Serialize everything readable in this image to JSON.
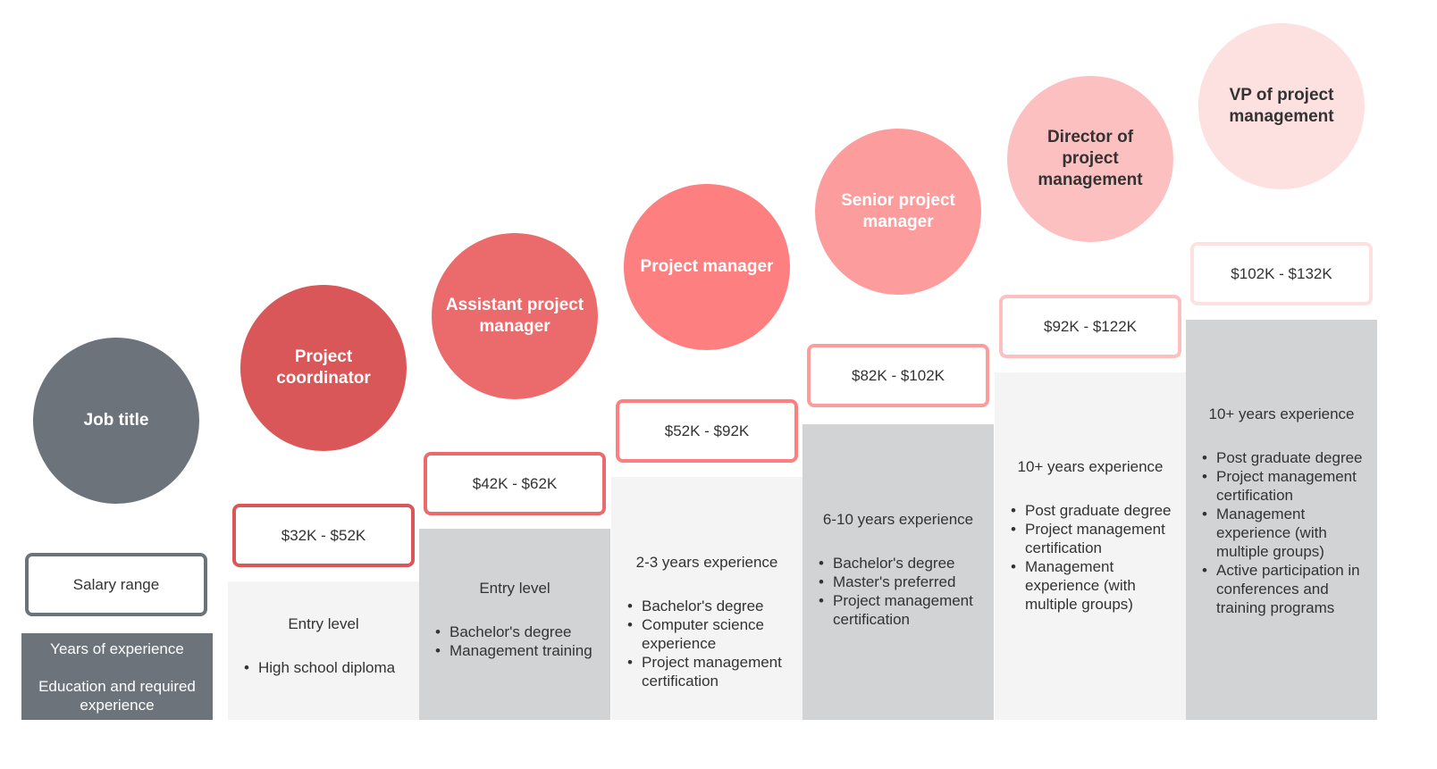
{
  "legend": {
    "job_title": "Job title",
    "salary_range": "Salary range",
    "years_of_experience": "Years of experience",
    "education": "Education and required experience",
    "circle_color": "#6d737b",
    "box_border_color": "#6d737b"
  },
  "levels": [
    {
      "title": "Project coordinator",
      "salary": "$32K - $52K",
      "experience": "Entry level",
      "requirements": [
        "High school diploma"
      ],
      "circle_color": "#d95758",
      "border_color": "#d95758",
      "title_color": "#ffffff",
      "block_color": "#f4f4f4"
    },
    {
      "title": "Assistant project manager",
      "salary": "$42K - $62K",
      "experience": "Entry level",
      "requirements": [
        "Bachelor's degree",
        "Management training"
      ],
      "circle_color": "#eb6b6c",
      "border_color": "#eb6b6c",
      "title_color": "#ffffff",
      "block_color": "#d2d3d5"
    },
    {
      "title": "Project manager",
      "salary": "$52K - $92K",
      "experience": "2-3 years experience",
      "requirements": [
        "Bachelor's degree",
        "Computer science experience",
        "Project management certification"
      ],
      "circle_color": "#fd7f7f",
      "border_color": "#fd7f7f",
      "title_color": "#ffffff",
      "block_color": "#f4f4f4"
    },
    {
      "title": "Senior project manager",
      "salary": "$82K - $102K",
      "experience": "6-10 years experience",
      "requirements": [
        "Bachelor's degree",
        "Master's preferred",
        "Project management certification"
      ],
      "circle_color": "#fd9c9c",
      "border_color": "#fd9c9c",
      "title_color": "#ffffff",
      "block_color": "#d2d3d5"
    },
    {
      "title": "Director of project management",
      "salary": "$92K - $122K",
      "experience": "10+ years experience",
      "requirements": [
        "Post graduate degree",
        "Project management certification",
        "Management experience (with multiple groups)"
      ],
      "circle_color": "#fdc0c0",
      "border_color": "#fdc0c0",
      "title_color": "#333333",
      "block_color": "#f4f4f4"
    },
    {
      "title": "VP of project management",
      "salary": "$102K - $132K",
      "experience": "10+ years experience",
      "requirements": [
        "Post graduate degree",
        "Project management certification",
        "Management experience (with multiple groups)",
        "Active participation in conferences and training programs"
      ],
      "circle_color": "#fde1e1",
      "border_color": "#fde1e1",
      "title_color": "#333333",
      "block_color": "#d2d3d5"
    }
  ]
}
